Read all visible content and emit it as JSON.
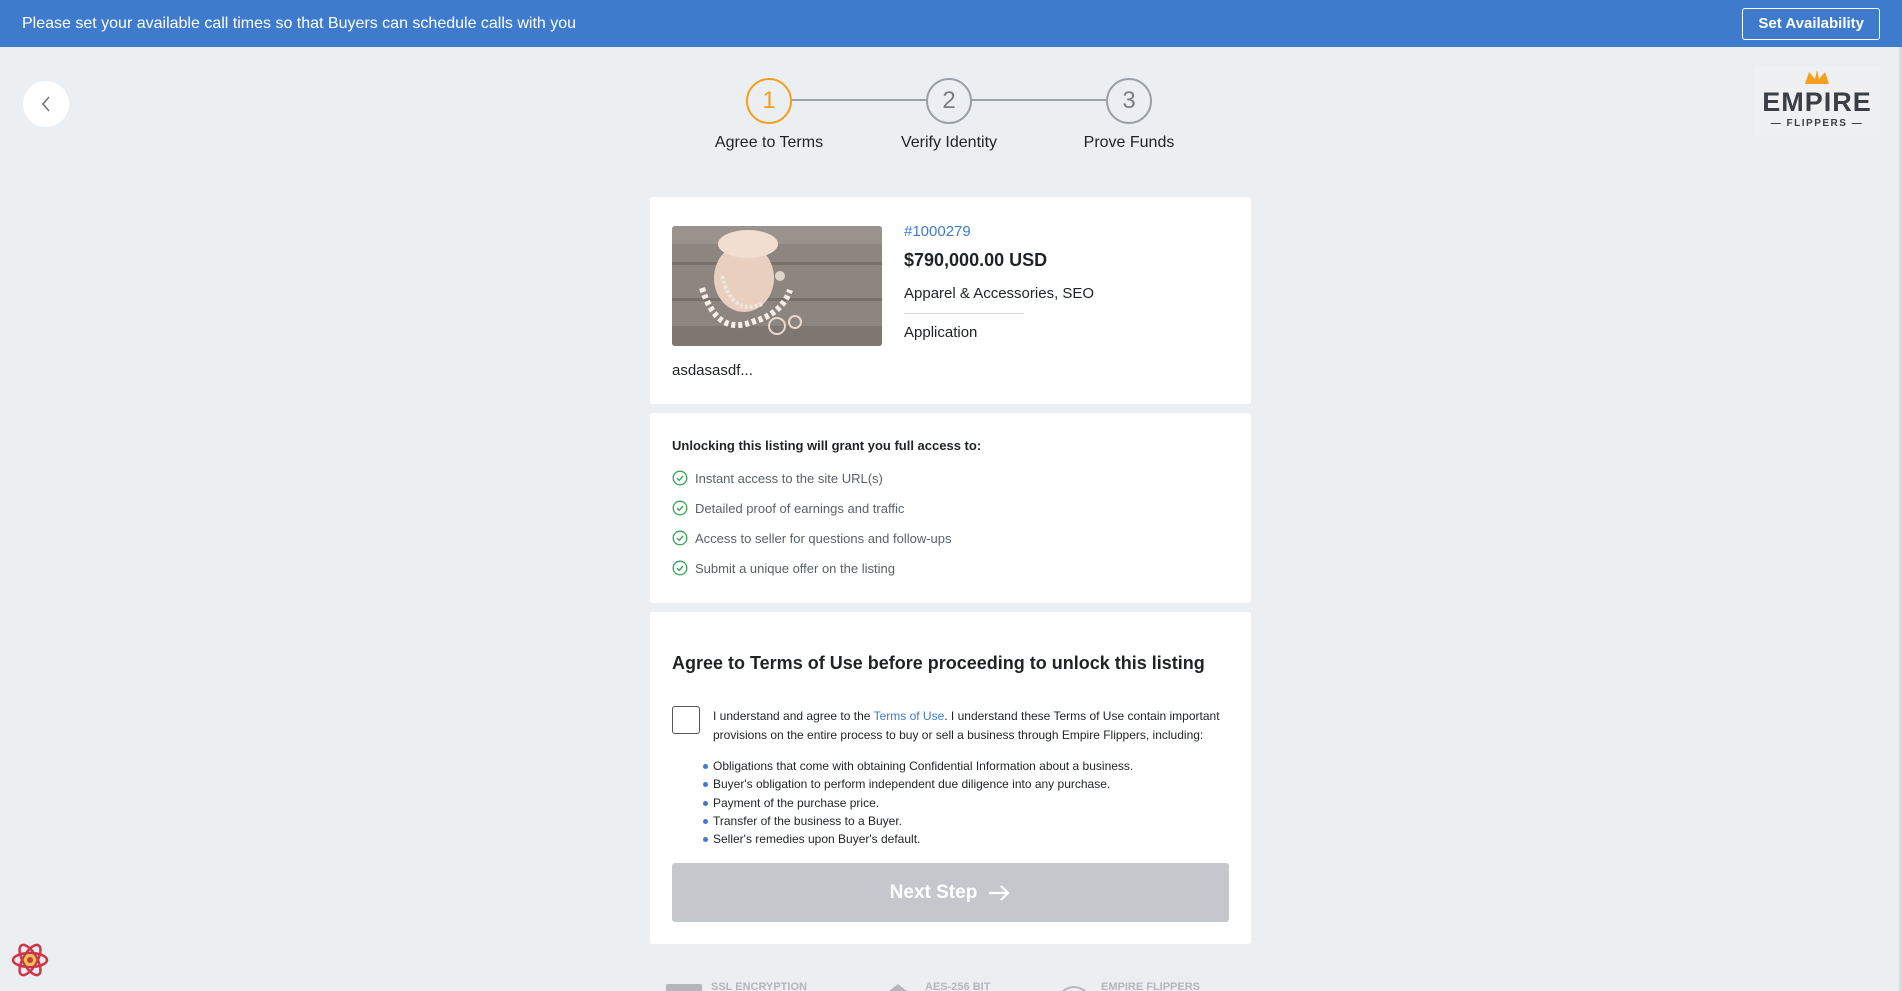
{
  "banner": {
    "message": "Please set your available call times so that Buyers can schedule calls with you",
    "button_label": "Set Availability"
  },
  "logo": {
    "line1": "EMPIRE",
    "line2": "— FLIPPERS —"
  },
  "steps": [
    {
      "number": "1",
      "label": "Agree to Terms",
      "active": true
    },
    {
      "number": "2",
      "label": "Verify Identity",
      "active": false
    },
    {
      "number": "3",
      "label": "Prove Funds",
      "active": false
    }
  ],
  "listing": {
    "id": "#1000279",
    "price": "$790,000.00 USD",
    "categories": "Apparel & Accessories, SEO",
    "type": "Application",
    "description": "asdasasdf..."
  },
  "access": {
    "title": "Unlocking this listing will grant you full access to:",
    "items": [
      "Instant access to the site URL(s)",
      "Detailed proof of earnings and traffic",
      "Access to seller for questions and follow-ups",
      "Submit a unique offer on the listing"
    ]
  },
  "terms": {
    "heading": "Agree to Terms of Use before proceeding to unlock this listing",
    "text_before": "I understand and agree to the ",
    "link": "Terms of Use",
    "text_after": ". I understand these Terms of Use contain important provisions on the entire process to buy or sell a business through Empire Flippers, including:",
    "checked": false,
    "bullets": [
      "Obligations that come with obtaining Confidential Information about a business.",
      "Buyer's obligation to perform independent due diligence into any purchase.",
      "Payment of the purchase price.",
      "Transfer of the business to a Buyer.",
      "Seller's remedies upon Buyer's default."
    ],
    "next_label": "Next Step"
  },
  "footer_badges": [
    "SSL ENCRYPTION",
    "AES-256 BIT",
    "EMPIRE FLIPPERS"
  ],
  "colors": {
    "banner": "#3e7bcd",
    "active_step": "#f4a01d",
    "check": "#3aa35a",
    "button_disabled": "#c4c8cc",
    "link": "#3e7bcd"
  }
}
